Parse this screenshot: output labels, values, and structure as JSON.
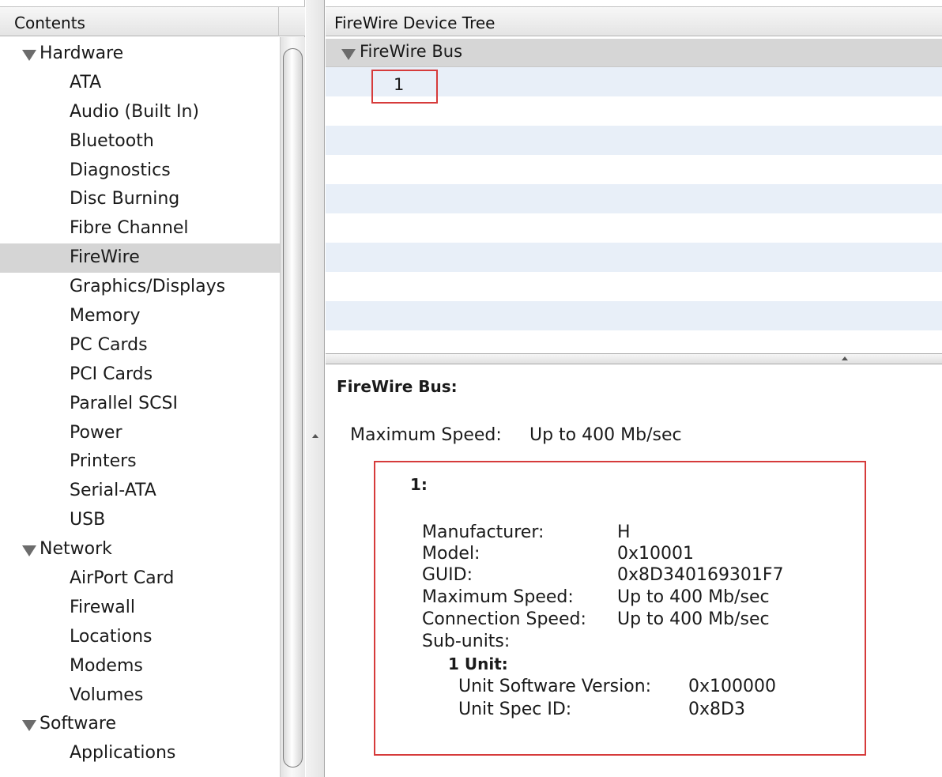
{
  "sidebar": {
    "header": "Contents",
    "rows": [
      {
        "label": "Hardware",
        "kind": "category",
        "expanded": true
      },
      {
        "label": "ATA",
        "kind": "item"
      },
      {
        "label": "Audio (Built In)",
        "kind": "item"
      },
      {
        "label": "Bluetooth",
        "kind": "item"
      },
      {
        "label": "Diagnostics",
        "kind": "item"
      },
      {
        "label": "Disc Burning",
        "kind": "item"
      },
      {
        "label": "Fibre Channel",
        "kind": "item"
      },
      {
        "label": "FireWire",
        "kind": "item",
        "selected": true
      },
      {
        "label": "Graphics/Displays",
        "kind": "item"
      },
      {
        "label": "Memory",
        "kind": "item"
      },
      {
        "label": "PC Cards",
        "kind": "item"
      },
      {
        "label": "PCI Cards",
        "kind": "item"
      },
      {
        "label": "Parallel SCSI",
        "kind": "item"
      },
      {
        "label": "Power",
        "kind": "item"
      },
      {
        "label": "Printers",
        "kind": "item"
      },
      {
        "label": "Serial-ATA",
        "kind": "item"
      },
      {
        "label": "USB",
        "kind": "item"
      },
      {
        "label": "Network",
        "kind": "category",
        "expanded": true
      },
      {
        "label": "AirPort Card",
        "kind": "item"
      },
      {
        "label": "Firewall",
        "kind": "item"
      },
      {
        "label": "Locations",
        "kind": "item"
      },
      {
        "label": "Modems",
        "kind": "item"
      },
      {
        "label": "Volumes",
        "kind": "item"
      },
      {
        "label": "Software",
        "kind": "category",
        "expanded": true
      },
      {
        "label": "Applications",
        "kind": "item"
      }
    ]
  },
  "tree": {
    "header": "FireWire Device Tree",
    "bus_label": "FireWire Bus",
    "device_label": "1"
  },
  "detail": {
    "title": "FireWire Bus:",
    "max_speed_label": "Maximum Speed:",
    "max_speed_value": "Up to 400 Mb/sec",
    "device": {
      "heading": "1:",
      "fields": [
        {
          "label": "Manufacturer:",
          "value": "H"
        },
        {
          "label": "Model:",
          "value": "0x10001"
        },
        {
          "label": "GUID:",
          "value": "0x8D340169301F7"
        },
        {
          "label": "Maximum Speed:",
          "value": "Up to 400 Mb/sec"
        },
        {
          "label": "Connection Speed:",
          "value": "Up to 400 Mb/sec"
        },
        {
          "label": "Sub-units:",
          "value": ""
        }
      ],
      "subunit_heading": "1 Unit:",
      "subunit_fields": [
        {
          "label": "Unit Software Version:",
          "value": "0x100000"
        },
        {
          "label": "Unit Spec ID:",
          "value": "0x8D3"
        }
      ]
    }
  },
  "colors": {
    "selection": "#d5d5d5",
    "stripe": "#e8eff8",
    "highlight_box": "#d63b3b"
  }
}
